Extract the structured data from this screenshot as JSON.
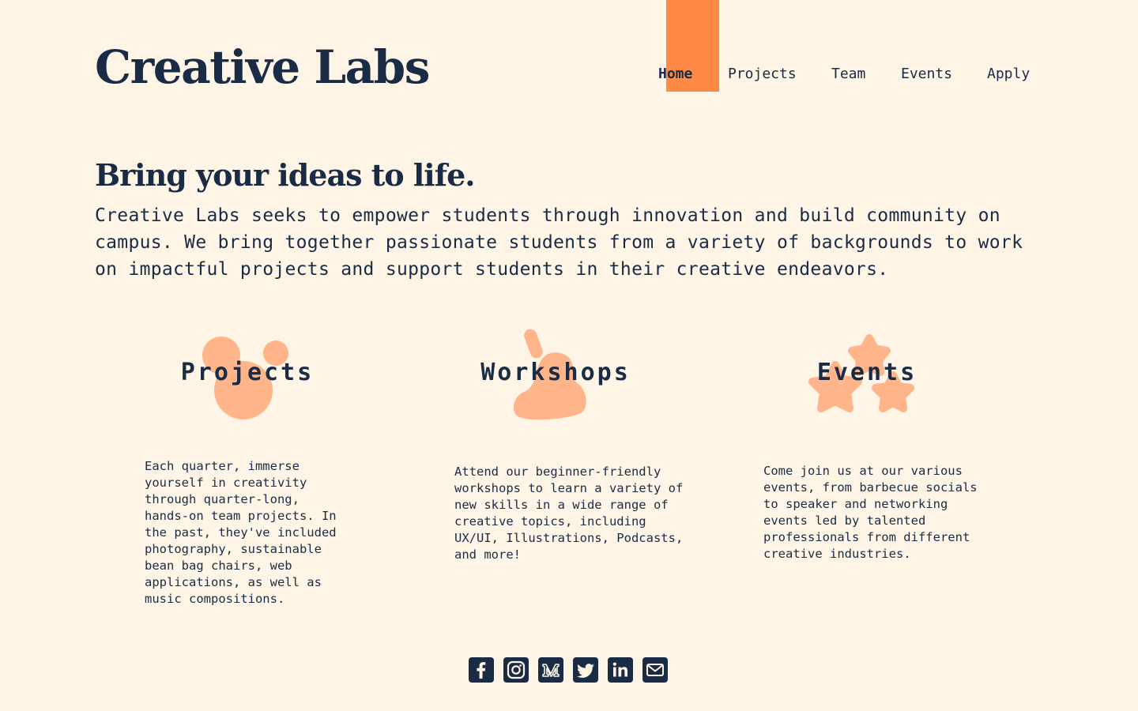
{
  "brand": {
    "name": "Creative Labs"
  },
  "nav": {
    "items": [
      "Home",
      "Projects",
      "Team",
      "Events",
      "Apply"
    ],
    "active": "Home",
    "highlight_color": "#ff8a45"
  },
  "hero": {
    "title": "Bring your ideas to life.",
    "text": "Creative Labs seeks to empower students through innovation and build community on campus. We bring together passionate students from a variety of backgrounds to work on impactful projects and support students in their creative endeavors."
  },
  "features": [
    {
      "title": "Projects",
      "icon": "bubbles-blob-icon",
      "text": "Each quarter, immerse yourself in creativity through quarter-long, hands-on team projects. In the past, they've included photography, sustainable bean bag chairs, web applications, as well as music compositions."
    },
    {
      "title": "Workshops",
      "icon": "paint-blob-icon",
      "text": "Attend our beginner-friendly workshops to learn a variety of new skills in a wide range of creative topics, including UX/UI, Illustrations, Podcasts, and more!"
    },
    {
      "title": "Events",
      "icon": "stars-blob-icon",
      "text": "Come join us at our various events, from barbecue socials to speaker and networking events led by talented professionals from different creative industries."
    }
  ],
  "social": [
    "facebook-icon",
    "instagram-icon",
    "medium-icon",
    "twitter-icon",
    "linkedin-icon",
    "email-icon"
  ],
  "colors": {
    "background": "#fff5e6",
    "text": "#1a2b45",
    "accent": "#ff8a45",
    "blob": "#ffb48a"
  }
}
